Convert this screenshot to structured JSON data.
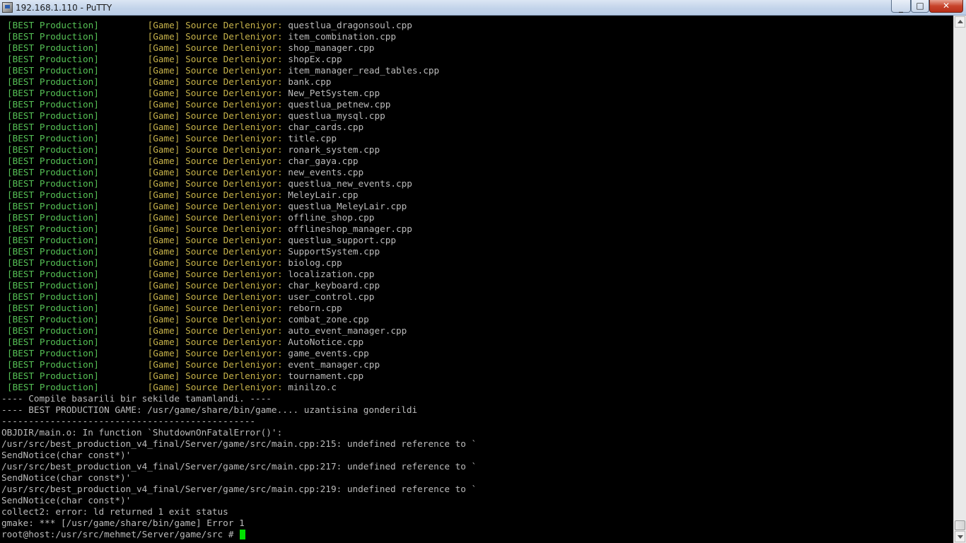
{
  "window": {
    "title": "192.168.1.110 - PuTTY",
    "minimize_glyph": "_",
    "maximize_glyph": "□",
    "close_glyph": "✕",
    "icon": "putty-icon"
  },
  "terminal": {
    "colors": {
      "background": "#000000",
      "default_text": "#bbbbbb",
      "bracket_tag": "#55c055",
      "game_tag": "#c6b24a",
      "cursor": "#00e000"
    },
    "build_tag": "[BEST Production]",
    "game_tag": "[Game]",
    "compile_message": "Source Derleniyor:",
    "compiled_files": [
      "questlua_dragonsoul.cpp",
      "item_combination.cpp",
      "shop_manager.cpp",
      "shopEx.cpp",
      "item_manager_read_tables.cpp",
      "bank.cpp",
      "New_PetSystem.cpp",
      "questlua_petnew.cpp",
      "questlua_mysql.cpp",
      "char_cards.cpp",
      "title.cpp",
      "ronark_system.cpp",
      "char_gaya.cpp",
      "new_events.cpp",
      "questlua_new_events.cpp",
      "MeleyLair.cpp",
      "questlua_MeleyLair.cpp",
      "offline_shop.cpp",
      "offlineshop_manager.cpp",
      "questlua_support.cpp",
      "SupportSystem.cpp",
      "biolog.cpp",
      "localization.cpp",
      "char_keyboard.cpp",
      "user_control.cpp",
      "reborn.cpp",
      "combat_zone.cpp",
      "auto_event_manager.cpp",
      "AutoNotice.cpp",
      "game_events.cpp",
      "event_manager.cpp",
      "tournament.cpp",
      "minilzo.c"
    ],
    "output_lines": [
      "---- Compile basarili bir sekilde tamamlandi. ----",
      "---- BEST PRODUCTION GAME: /usr/game/share/bin/game.... uzantisina gonderildi",
      "-----------------------------------------------",
      "OBJDIR/main.o: In function `ShutdownOnFatalError()':",
      "/usr/src/best_production_v4_final/Server/game/src/main.cpp:215: undefined reference to `",
      "SendNotice(char const*)'",
      "/usr/src/best_production_v4_final/Server/game/src/main.cpp:217: undefined reference to `",
      "SendNotice(char const*)'",
      "/usr/src/best_production_v4_final/Server/game/src/main.cpp:219: undefined reference to `",
      "SendNotice(char const*)'",
      "collect2: error: ld returned 1 exit status",
      "gmake: *** [/usr/game/share/bin/game] Error 1"
    ],
    "prompt": "root@host:/usr/src/mehmet/Server/game/src # "
  }
}
